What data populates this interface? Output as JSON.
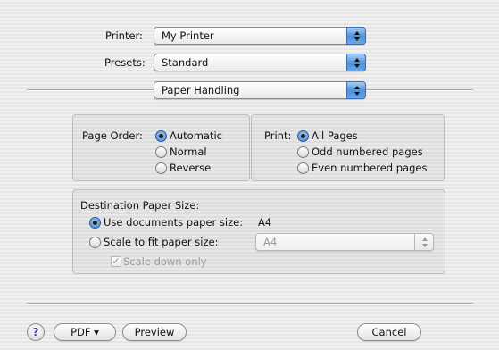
{
  "printer": {
    "label": "Printer:",
    "value": "My Printer"
  },
  "presets": {
    "label": "Presets:",
    "value": "Standard"
  },
  "panel_select": {
    "value": "Paper Handling"
  },
  "page_order": {
    "label": "Page Order:",
    "options": [
      "Automatic",
      "Normal",
      "Reverse"
    ],
    "selected": "Automatic"
  },
  "print_pages": {
    "label": "Print:",
    "options": [
      "All Pages",
      "Odd numbered pages",
      "Even numbered pages"
    ],
    "selected": "All Pages"
  },
  "destination": {
    "title": "Destination Paper Size:",
    "use_doc_label": "Use documents paper size:",
    "use_doc_value": "A4",
    "scale_label": "Scale to fit paper size:",
    "scale_value": "A4",
    "scale_down_label": "Scale down only"
  },
  "footer": {
    "help": "?",
    "pdf": "PDF ▾",
    "preview": "Preview",
    "cancel": "Cancel"
  }
}
